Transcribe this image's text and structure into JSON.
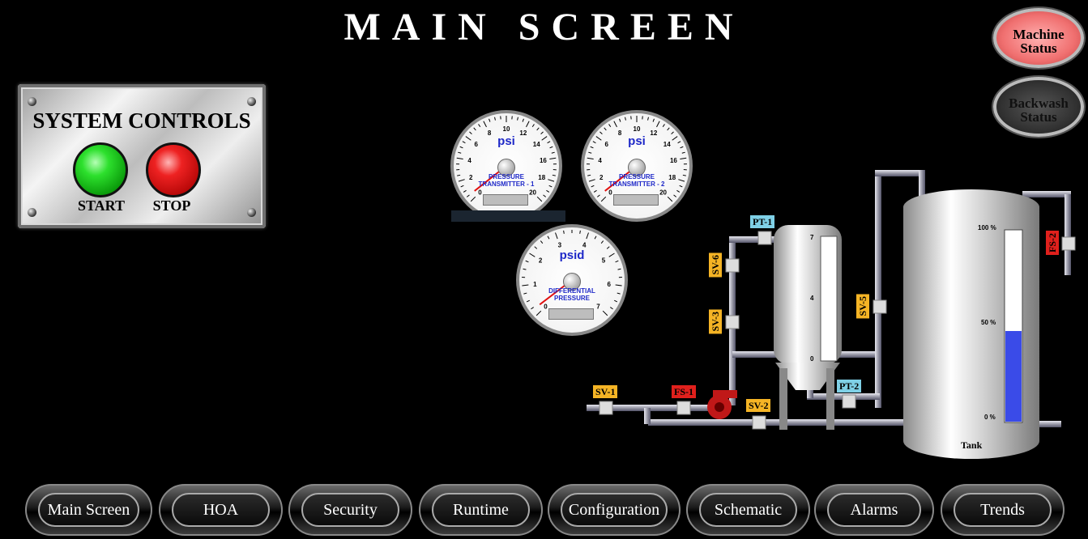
{
  "header": {
    "title": "MAIN SCREEN"
  },
  "system_controls": {
    "title": "SYSTEM CONTROLS",
    "start_label": "START",
    "stop_label": "STOP"
  },
  "status_buttons": {
    "machine_line1": "Machine",
    "machine_line2": "Status",
    "backwash_line1": "Backwash",
    "backwash_line2": "Status"
  },
  "gauges": [
    {
      "unit": "psi",
      "name_line1": "PRESSURE",
      "name_line2": "TRANSMITTER - 1",
      "ticks": [
        "0",
        "2",
        "4",
        "6",
        "8",
        "10",
        "12",
        "14",
        "16",
        "18",
        "20"
      ],
      "min": 0,
      "max": 20,
      "value": 0.5
    },
    {
      "unit": "psi",
      "name_line1": "PRESSURE",
      "name_line2": "TRANSMITTER - 2",
      "ticks": [
        "0",
        "2",
        "4",
        "6",
        "8",
        "10",
        "12",
        "14",
        "16",
        "18",
        "20"
      ],
      "min": 0,
      "max": 20,
      "value": 0.5
    },
    {
      "unit": "psid",
      "name_line1": "DIFFERENTIAL",
      "name_line2": "PRESSURE",
      "ticks": [
        "0",
        "1",
        "2",
        "3",
        "4",
        "5",
        "6",
        "7"
      ],
      "min": 0,
      "max": 7,
      "value": 0.2
    }
  ],
  "process": {
    "tags": {
      "pt1": "PT-1",
      "pt2": "PT-2",
      "sv1": "SV-1",
      "sv2": "SV-2",
      "sv3": "SV-3",
      "sv5": "SV-5",
      "sv6": "SV-6",
      "fs1": "FS-1",
      "fs2": "FS-2"
    },
    "filter_scale": [
      "7",
      "4",
      "0"
    ],
    "tank_label": "Tank",
    "tank_scale": [
      "100 %",
      "50 %",
      "0 %"
    ],
    "tank_level": 0.47,
    "colors": {
      "tag_valve": "#f5b425",
      "tag_transmitter": "#7fd0e6",
      "tag_switch": "#e0201c",
      "tank_fill": "#3a4be8"
    }
  },
  "nav": [
    {
      "label": "Main Screen"
    },
    {
      "label": "HOA"
    },
    {
      "label": "Security"
    },
    {
      "label": "Runtime"
    },
    {
      "label": "Configuration"
    },
    {
      "label": "Schematic"
    },
    {
      "label": "Alarms"
    },
    {
      "label": "Trends"
    }
  ]
}
